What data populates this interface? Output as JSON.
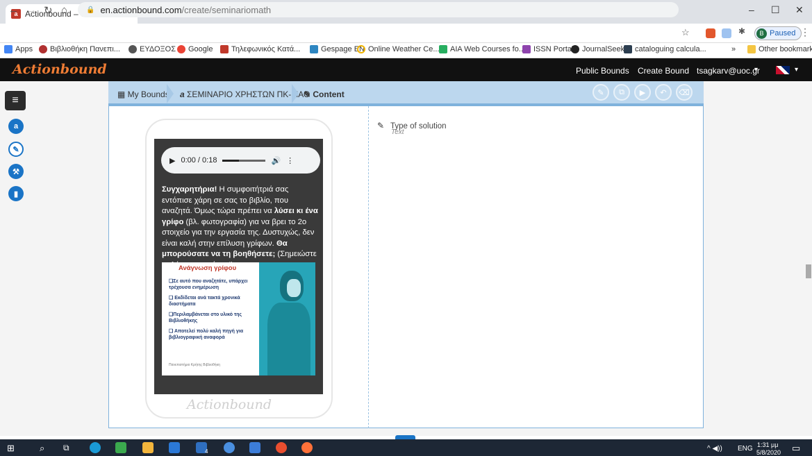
{
  "browser": {
    "tab_title": "Actionbound – edit Bound | Crea",
    "tab_favicon": "ab",
    "new_tab": "+",
    "url_host": "en.actionbound.com",
    "url_path": "/create/seminariomath",
    "profile_initial": "B",
    "profile_status": "Paused",
    "win_min": "–",
    "win_max": "☐",
    "win_close": "✕"
  },
  "bookmarks": {
    "items": [
      "Apps",
      "Βιβλιοθήκη Πανεπι...",
      "ΕΥΔΟΞΟΣ",
      "Google",
      "Τηλεφωνικός Κατά...",
      "Gespage EN",
      "Online Weather Ce...",
      "AIA Web Courses fo...",
      "ISSN Portal",
      "JournalSeek",
      "cataloguing calcula..."
    ],
    "more": "»",
    "other": "Other bookmarks"
  },
  "app": {
    "logo": "Actionbound",
    "nav_public": "Public Bounds",
    "nav_create": "Create Bound",
    "nav_user": "tsagkarv@uoc.gr",
    "user_caret": "▾",
    "lang_caret": "▾"
  },
  "breadcrumb": {
    "my_bounds": "My Bounds",
    "bound_name": "ΣΕΜΙΝΑΡΙΟ ΧΡΗΣΤΩΝ ΠΚ-ΜΑΘ",
    "content": "Content"
  },
  "audio": {
    "time": "0:00 / 0:18",
    "play": "▶",
    "volume": "🔊",
    "more": "⋮"
  },
  "message": {
    "p1_bold": "Συγχαρητήρια!",
    "p1_rest": " Η συμφοιτήτριά σας εντόπισε χάρη σε σας το βιβλίο, που αναζητά. Όμως τώρα πρέπει να ",
    "p2_bold": "λύσει κι ένα γρίφο",
    "p2_rest": " (βλ. φωτογραφία) για να βρει το 2ο στοιχείο για την εργασία της. Δυστυχώς, δεν είναι καλή στην επίλυση γρίφων.",
    "p3_bold": "Θα μπορούσατε να τη βοηθήσετε;",
    "p3_rest": " (Σημειώστε τη λύση του γρίφου!)"
  },
  "riddle": {
    "title": "Ανάγνωση γρίφου",
    "items": [
      "❑Σε αυτό που αναζητάτε, υπάρχει τρέχουσα ενημέρωση",
      "❑ Εκδίδεται ανά τακτά χρονικά διαστήματα",
      "❑Περιλαμβάνεται στο υλικό της Βιβλιοθήκης",
      "❑ Αποτελεί πολύ καλή πηγή για βιβλιογραφική αναφορά"
    ],
    "footer": "Πανεπιστήμιο Κρήτης Βιβλιοθήκη"
  },
  "phone_logo": "Actionbound",
  "form": {
    "label": "Type of solution",
    "value": "Text"
  },
  "taskbar": {
    "lang": "ENG",
    "time": "1:31 μμ",
    "date": "5/8/2020",
    "badge": "4"
  },
  "colors": {
    "accent": "#1a74c6",
    "brand": "#ef7c34",
    "breadcrumb_bg": "#bcd7ee"
  }
}
